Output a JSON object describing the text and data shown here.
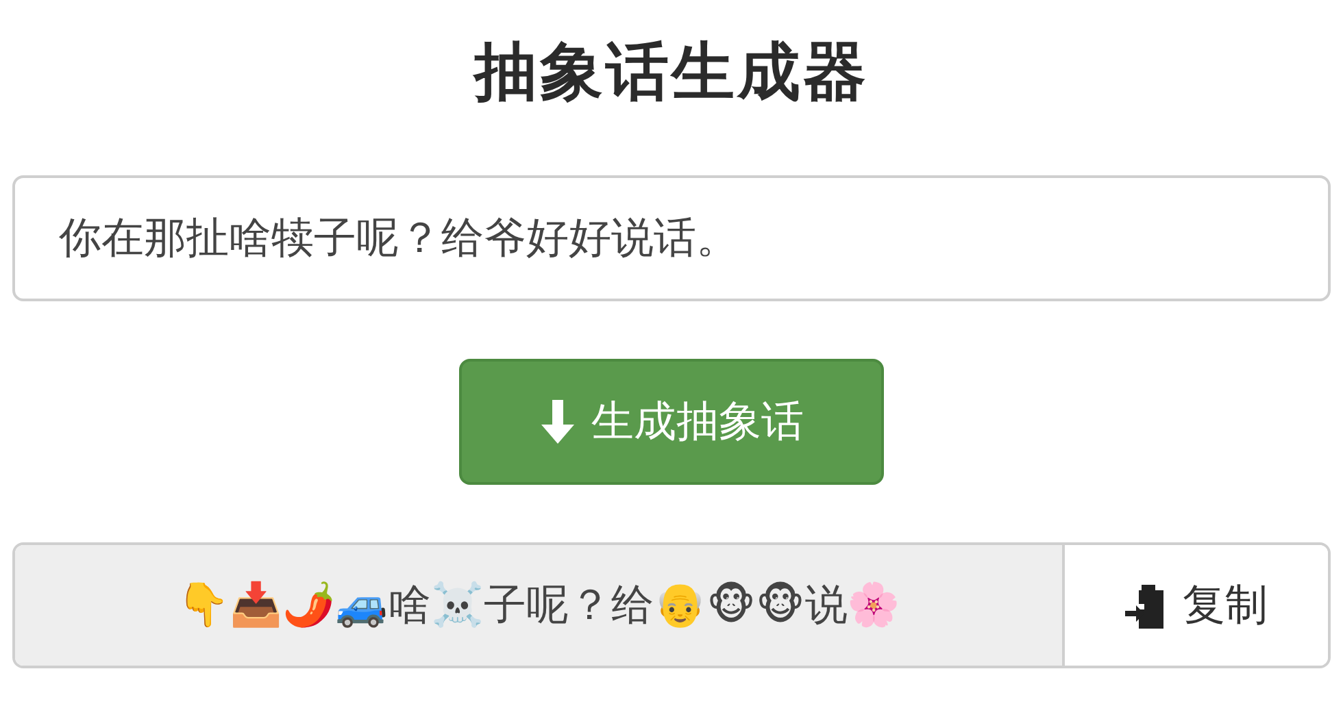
{
  "title": "抽象话生成器",
  "input": {
    "value": "你在那扯啥犊子呢？给爷好好说话。"
  },
  "generate_button": {
    "label": "生成抽象话"
  },
  "output": {
    "value": "👇📥🌶️🚙啥☠️子呢？给👴🐵🐵说🌸",
    "copy_label": "复制"
  }
}
